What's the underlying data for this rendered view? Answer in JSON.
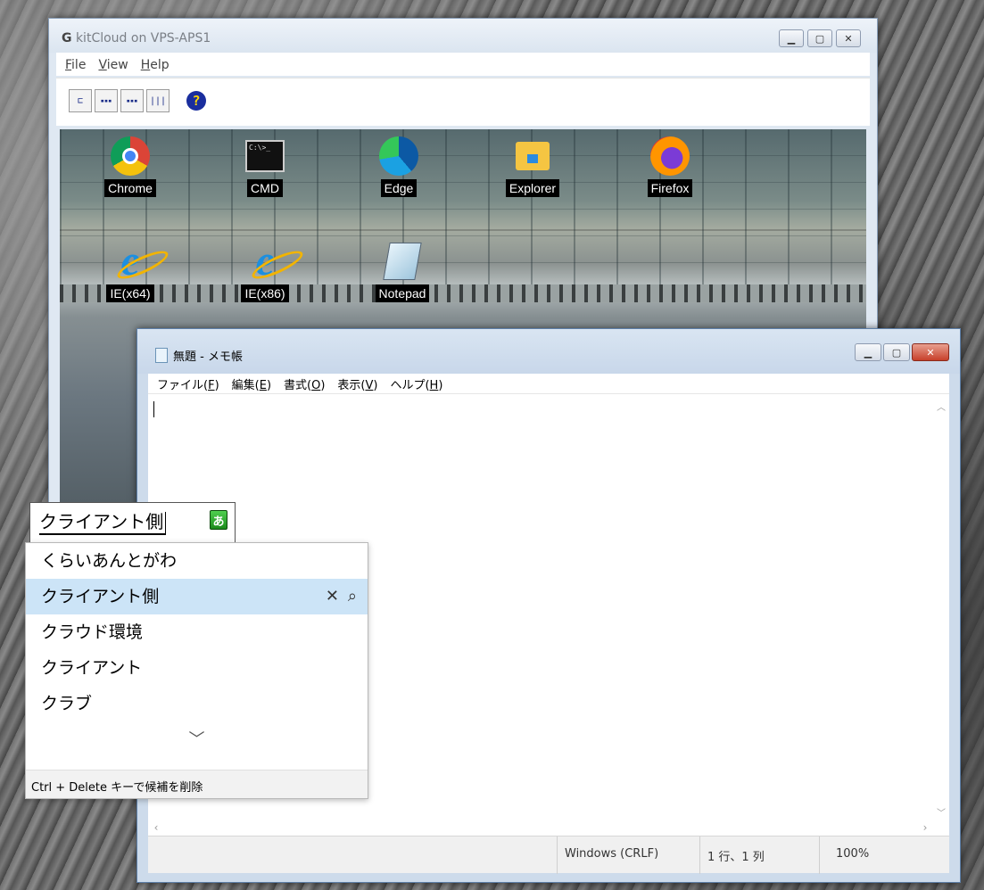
{
  "kitcloud": {
    "title": "kitCloud on VPS-APS1",
    "menu": [
      {
        "pre": "",
        "key": "F",
        "post": "ile"
      },
      {
        "pre": "",
        "key": "V",
        "post": "iew"
      },
      {
        "pre": "",
        "key": "H",
        "post": "elp"
      }
    ],
    "toolbar_glyphs": {
      "tree": "⊏",
      "large": "▪▪▪",
      "small": "▪▪▪",
      "detail": "|||",
      "help": "?"
    },
    "desktop_icons": [
      {
        "label": "Chrome",
        "icon": "chrome-icon"
      },
      {
        "label": "CMD",
        "icon": "cmd-icon"
      },
      {
        "label": "Edge",
        "icon": "edge-icon"
      },
      {
        "label": "Explorer",
        "icon": "explorer-icon"
      },
      {
        "label": "Firefox",
        "icon": "firefox-icon"
      },
      {
        "label": "IE(x64)",
        "icon": "ie-icon"
      },
      {
        "label": "IE(x86)",
        "icon": "ie-icon"
      },
      {
        "label": "Notepad",
        "icon": "notepad-icon"
      }
    ]
  },
  "notepad": {
    "title": "無題 - メモ帳",
    "menu": [
      {
        "pre": "ファイル(",
        "key": "F",
        "post": ")"
      },
      {
        "pre": "編集(",
        "key": "E",
        "post": ")"
      },
      {
        "pre": "書式(",
        "key": "O",
        "post": ")"
      },
      {
        "pre": "表示(",
        "key": "V",
        "post": ")"
      },
      {
        "pre": "ヘルプ(",
        "key": "H",
        "post": ")"
      }
    ],
    "status": {
      "line_ending": "Windows (CRLF)",
      "position": "1 行、1 列",
      "zoom": "100%"
    }
  },
  "ime": {
    "composition": "クライアント側",
    "mode_glyph": "あ",
    "candidates": [
      {
        "text": "くらいあんとがわ",
        "selected": false
      },
      {
        "text": "クライアント側",
        "selected": true
      },
      {
        "text": "クラウド環境",
        "selected": false
      },
      {
        "text": "クライアント",
        "selected": false
      },
      {
        "text": "クラブ",
        "selected": false
      }
    ],
    "hint": "Ctrl + Delete キーで候補を削除"
  },
  "colors": {
    "selection": "#cce4f7",
    "window_border": "#5d7fa8",
    "ime_mode": "#1b8a1b"
  }
}
